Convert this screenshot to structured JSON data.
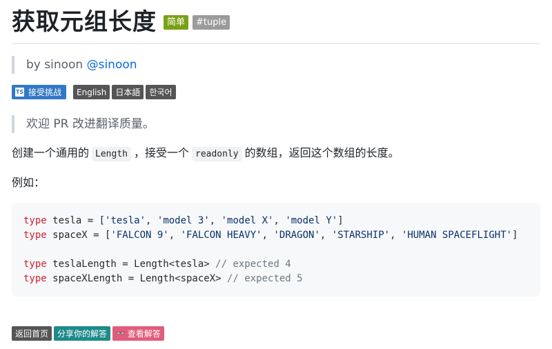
{
  "header": {
    "title": "获取元组长度",
    "difficulty": "简单",
    "tag": "#tuple"
  },
  "author": {
    "prefix": "by sinoon ",
    "handle": "@sinoon"
  },
  "chips": {
    "challenge": "接受挑战",
    "challenge_icon": "TS",
    "languages": [
      "English",
      "日本語",
      "한국어"
    ]
  },
  "notice": "欢迎 PR 改进翻译质量。",
  "description": {
    "before": "创建一个通用的",
    "code1": "Length",
    "middle": "，接受一个",
    "code2": "readonly",
    "after": "的数组，返回这个数组的长度。"
  },
  "example_label": "例如：",
  "code": {
    "kw": "type",
    "line1": {
      "head": " tesla = [",
      "s1": "'tesla'",
      "s2": "'model 3'",
      "s3": "'model X'",
      "s4": "'model Y'",
      "tail": "]"
    },
    "line2": {
      "head": " spaceX = [",
      "s1": "'FALCON 9'",
      "s2": "'FALCON HEAVY'",
      "s3": "'DRAGON'",
      "s4": "'STARSHIP'",
      "s5": "'HUMAN SPACEFLIGHT'",
      "tail": "]"
    },
    "line4": {
      "body": " teslaLength = Length<tesla> ",
      "comment": "// expected 4"
    },
    "line5": {
      "body": " spaceXLength = Length<spaceX> ",
      "comment": "// expected 5"
    }
  },
  "footer": {
    "home": "返回首页",
    "share": "分享你的解答",
    "solutions": "查看解答"
  },
  "colors": {
    "easy_badge": "#7aa116",
    "tag_badge": "#9b9b9b",
    "challenge_chip": "#3178c6",
    "language_chip": "#555555",
    "share_button": "#1f8a8a",
    "solutions_button": "#e05d7b",
    "keyword": "#cf222e",
    "string": "#0a3069",
    "comment": "#6e7781"
  }
}
